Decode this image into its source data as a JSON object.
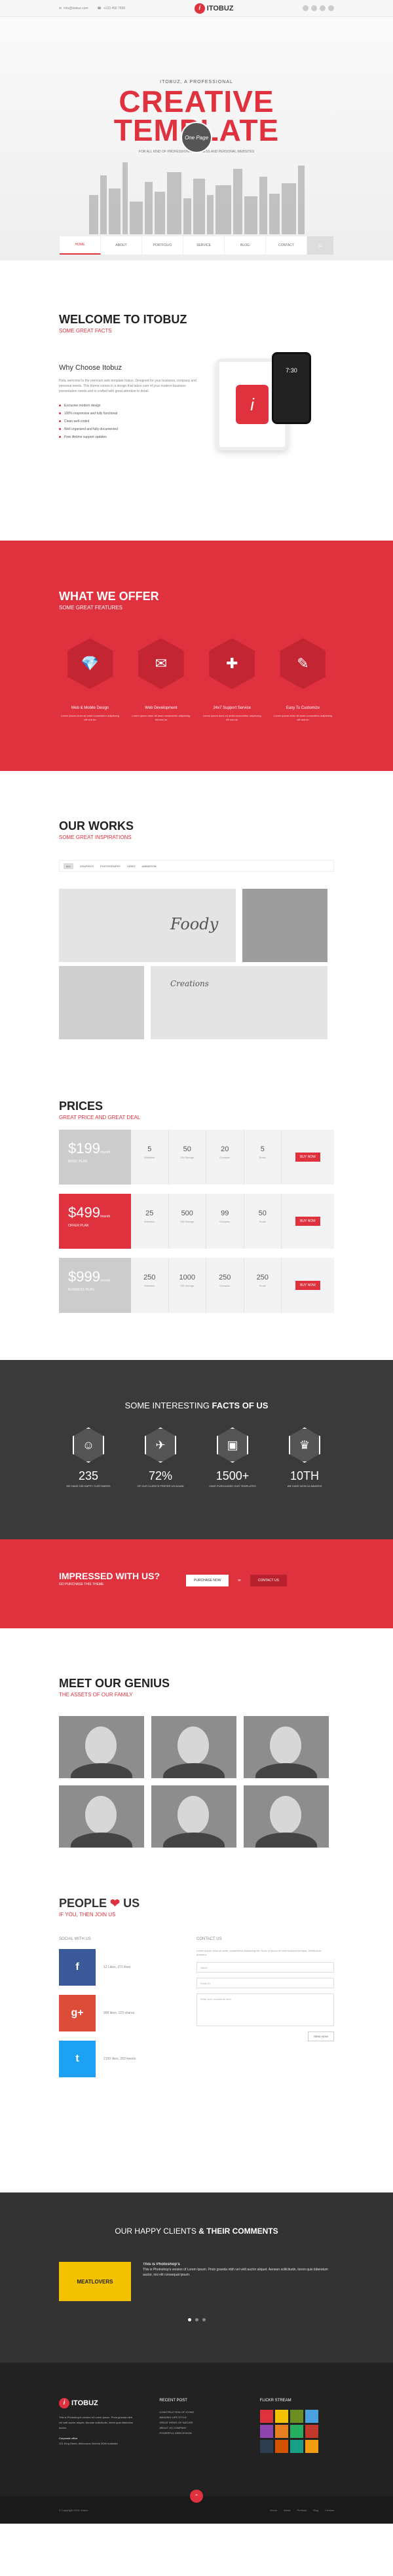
{
  "topbar": {
    "email": "info@itobuz.com",
    "phone": "+123 456 7890"
  },
  "brand": {
    "logo_mark": "i",
    "name": "ITOBUZ"
  },
  "hero": {
    "kicker": "ITOBUZ, A PROFESSIONAL",
    "title_line1": "CREATIVE",
    "title_line2": "TEMPLATE",
    "badge": "One Page",
    "subtitle": "FOR ALL KIND OF PROFESSIONAL BUSINESS AND PERSONAL WEBSITES"
  },
  "nav": {
    "items": [
      "HOME",
      "ABOUT",
      "PORTFOLIO",
      "SERVICE",
      "BLOG",
      "CONTACT"
    ],
    "search_icon": "⌕"
  },
  "welcome": {
    "title": "WELCOME TO ITOBUZ",
    "subtitle": "SOME GREAT FACTS",
    "heading": "Why Choose Itobuz",
    "body": "Hola, welcome to the premium web template Itobuz. Designed for your business, company and personal needs. This theme comes in a design that takes care of your modern business presentation needs and is crafted with great attention to detail.",
    "bullets": [
      "Exclusive modern design",
      "100% responsive and fully functional",
      "Clean well-coded",
      "Well organized and fully documented",
      "Free lifetime support updates"
    ],
    "clock": "7:30"
  },
  "offer": {
    "title": "WHAT WE OFFER",
    "subtitle": "SOME GREAT FEATURES",
    "items": [
      {
        "icon": "💎",
        "title": "Web & Mobile Design",
        "desc": "Lorem ipsum dolor sit amet consectetur adipiscing elit sed do"
      },
      {
        "icon": "✉",
        "title": "Web Development",
        "desc": "Lorem ipsum dolor sit amet consectetur adipiscing elit sed do"
      },
      {
        "icon": "✚",
        "title": "24x7 Support Service",
        "desc": "Lorem ipsum dolor sit amet consectetur adipiscing elit sed do"
      },
      {
        "icon": "✎",
        "title": "Easy To Customize",
        "desc": "Lorem ipsum dolor sit amet consectetur adipiscing elit sed do"
      }
    ]
  },
  "works": {
    "title": "OUR WORKS",
    "subtitle": "SOME GREAT INSPIRATIONS",
    "filters": [
      "ALL",
      "GRAPHICS",
      "PHOTOGRAPHY",
      "VIDEO",
      "ANIMATION"
    ],
    "tile_label": "Foody",
    "tile_label2": "Creations"
  },
  "prices": {
    "title": "PRICES",
    "subtitle": "GREAT PRICE AND GREAT DEAL",
    "plans": [
      {
        "price": "$199",
        "per": "/month",
        "name": "BASIC PLAN",
        "color": "#cccccc",
        "vals": [
          "5",
          "50",
          "20",
          "5"
        ],
        "labels": [
          "Websites",
          "GB Storage",
          "Domains",
          "Email"
        ],
        "cta": "BUY NOW"
      },
      {
        "price": "$499",
        "per": "/month",
        "name": "OFFER PLAN",
        "color": "#e0313f",
        "vals": [
          "25",
          "500",
          "99",
          "50"
        ],
        "labels": [
          "Websites",
          "GB Storage",
          "Domains",
          "Email"
        ],
        "cta": "BUY NOW"
      },
      {
        "price": "$999",
        "per": "/month",
        "name": "BUSINESS PLAN",
        "color": "#cccccc",
        "vals": [
          "250",
          "1000",
          "250",
          "250"
        ],
        "labels": [
          "Websites",
          "GB Storage",
          "Domains",
          "Email"
        ],
        "cta": "BUY NOW"
      }
    ]
  },
  "facts": {
    "title_pre": "SOME INTERESTING",
    "title_bold": "FACTS OF US",
    "items": [
      {
        "icon": "☺",
        "num": "235",
        "label": "WE HAVE 235 HAPPY CUSTOMERS"
      },
      {
        "icon": "✈",
        "num": "72%",
        "label": "OF OUR CLIENTS PREFER US AGAIN"
      },
      {
        "icon": "▣",
        "num": "1500+",
        "label": "HAVE PURCHASED OUR TEMPLATES"
      },
      {
        "icon": "♛",
        "num": "10TH",
        "label": "WE HAVE WON 10 AWARDS"
      }
    ]
  },
  "impressed": {
    "title": "IMPRESSED WITH US?",
    "sub": "GO PURCHASE THIS THEME",
    "btn_primary": "PURCHASE NOW",
    "btn_or": "or",
    "btn_secondary": "CONTACT US"
  },
  "team": {
    "title": "MEET OUR GENIUS",
    "subtitle": "THE ASSETS OF OUR FAMILY"
  },
  "contact": {
    "title_pre": "PEOPLE",
    "heart": "❤",
    "title_post": "US",
    "subtitle": "IF YOU, THEN JOIN US",
    "social_title": "SOCIAL WITH US",
    "socials": [
      {
        "icon": "f",
        "color": "#3b5998",
        "text": "12 Likes, 271 likes"
      },
      {
        "icon": "g+",
        "color": "#dd4b39",
        "text": "999 likes, 123 shares"
      },
      {
        "icon": "t",
        "color": "#1da1f2",
        "text": "2199 likes, 350 tweets"
      }
    ],
    "contact_title": "CONTACT US",
    "contact_text": "Lorem ipsum dolor sit amet, consectetur adipiscing elit. Nunc id ipsum et enim tincidunt tempus. Vestibulum pharetra.",
    "name_ph": "Name",
    "email_ph": "Email ID",
    "msg_ph": "Write your comments here",
    "send": "SEND NOW"
  },
  "testimonials": {
    "title_pre": "OUR HAPPY CLIENTS",
    "amp": "&",
    "title_post": "THEIR COMMENTS",
    "card": "MEATLOVERS",
    "author": "This is Photoshop's",
    "quote": "This is Photoshop's version of Lorem Ipsum. Proin gravida nibh vel velit auctor aliquet. Aenean sollicitudin, lorem quis bibendum auctor, nisi elit consequat ipsum."
  },
  "footer": {
    "about": "This is Photoshop's version of Lorem Ipsum. Proin gravida nibh vel velit auctor aliquet. Aenean sollicitudin, lorem quis bibendum auctor.",
    "office_title": "Corporate office",
    "office": "121 King Street, Melbourne Victoria 3000 Australia",
    "recent_title": "RECENT POST",
    "posts": [
      "CONSTRUCTION OF ICONS",
      "AMAZING LIFE STYLE",
      "GREAT VIEWS OF NATURE",
      "ABOUT US COMPANY",
      "POWERFUL WEB DESIGN"
    ],
    "flickr_title": "FLICKR STREAM",
    "flickr_colors": [
      "#e0313f",
      "#f2c200",
      "#6b8e23",
      "#4aa3df",
      "#8e44ad",
      "#e67e22",
      "#27ae60",
      "#c0392b",
      "#2c3e50",
      "#d35400",
      "#16a085",
      "#f39c12"
    ],
    "copyright": "© Copyright 2014, Itobuz",
    "links": [
      "Home",
      "About",
      "Portfolio",
      "Blog",
      "Contact"
    ],
    "up_icon": "⌃"
  }
}
